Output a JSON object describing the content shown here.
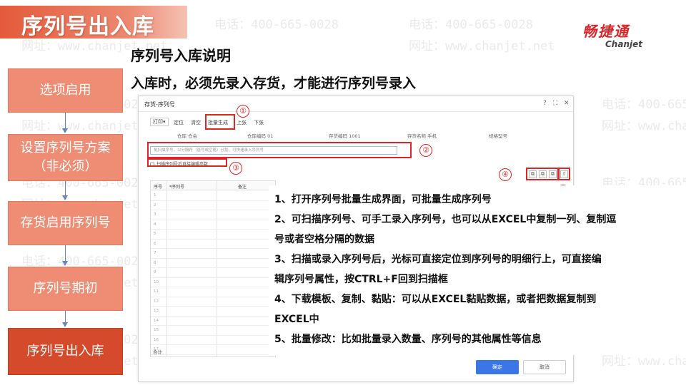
{
  "watermark": {
    "phone": "电话：400-665-0028",
    "site": "网址：www.chanjet.net"
  },
  "header": {
    "title": "序列号出入库",
    "logo_cn": "畅捷通",
    "logo_en": "Chanjet",
    "brand_color": "#d8262a",
    "accent_color": "#e45a3a"
  },
  "content": {
    "subtitle": "序列号入库说明",
    "lead": "入库时，必须先录入存货，才能进行序列号录入"
  },
  "steps": [
    {
      "label": "选项启用",
      "active": false
    },
    {
      "label": "设置序列号方案（非必须）",
      "active": false
    },
    {
      "label": "存货启用序列号",
      "active": false
    },
    {
      "label": "序列号期初",
      "active": false
    },
    {
      "label": "序列号出入库",
      "active": true
    }
  ],
  "dialog": {
    "title": "存货-序列号",
    "controls": {
      "help": "?",
      "max": "⛶",
      "close": "✕"
    },
    "toolbar": {
      "print": "打印▾",
      "locate": "定位",
      "clear": "清空",
      "batch": "批量生成",
      "up": "上张",
      "down": "下张"
    },
    "info": {
      "warehouse": "仓库 仓会",
      "warehouse_code": "仓库编码 01",
      "item_code": "存货编码 1001",
      "item_name": "存货名称 手机",
      "spec": "规格型号"
    },
    "input_placeholder": "批扫描序号，以分隔符（逗号或空格）分割，可快速录入序列号",
    "scan_option": "扫描序列号后直接编辑参数",
    "icons": [
      "⧉",
      "⧉",
      "⧉",
      "⇧"
    ],
    "grid": {
      "headers": [
        "序号",
        "*序列号",
        "备注"
      ],
      "rows": [
        "1",
        "2",
        "3",
        "4",
        "5",
        "6",
        "7",
        "8",
        "9",
        "10",
        "11",
        "12",
        "13",
        "14",
        "15",
        "16",
        "17"
      ],
      "total_label": "合计"
    },
    "ok": "确定",
    "cancel": "取消"
  },
  "annotations": [
    "①",
    "②",
    "③",
    "④",
    "⑤"
  ],
  "notes": [
    "1、打开序列号批量生成界面，可批量生成序列号",
    "2、可扫描序列号、可手工录入序列号，也可以从EXCEL中复制一列、复制逗",
    "号或者空格分隔的数据",
    "3、扫描或录入序列号后，光标可直接定位到序列号的明细行上，可直接编",
    "辑序列号属性，按CTRL+F回到扫描框",
    "4、下载模板、复制、黏贴：可以从EXCEL黏贴数据，或者把数据复制到",
    "EXCEL中",
    "5、批量修改：比如批量录入数量、序列号的其他属性等信息"
  ]
}
